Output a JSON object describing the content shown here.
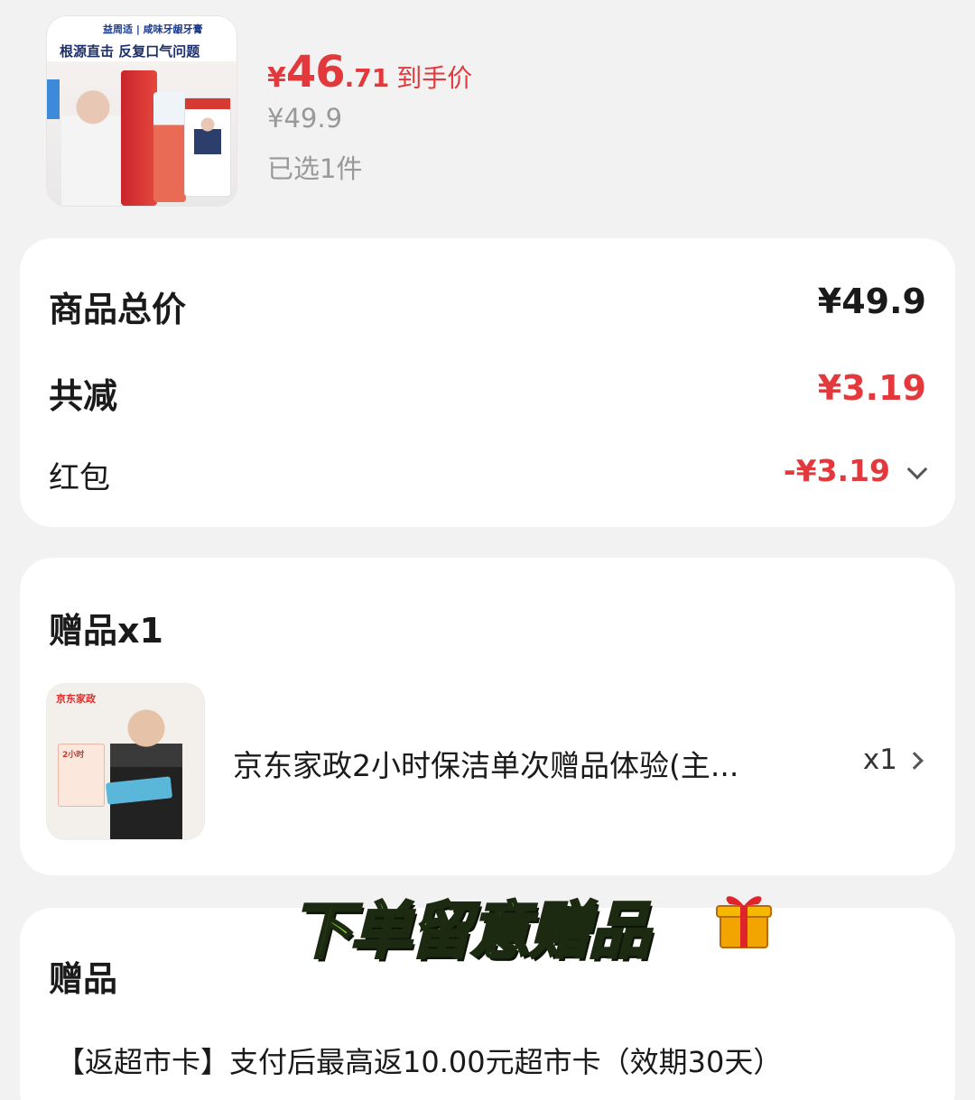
{
  "product": {
    "thumb_brand": "益周适 | 咸味牙龈牙膏",
    "thumb_headline": "根源直击 反复口气问题",
    "price_symbol": "¥",
    "price_integer": "46",
    "price_decimal": ".71",
    "price_suffix": "到手价",
    "original_price": "¥49.9",
    "selected_count": "已选1件"
  },
  "summary": {
    "total_label": "商品总价",
    "total_value": "¥49.9",
    "reduction_label": "共减",
    "reduction_value": "¥3.19",
    "redpack_label": "红包",
    "redpack_value": "-¥3.19"
  },
  "gift": {
    "title": "赠品x1",
    "thumb_brand": "京东家政",
    "thumb_tag": "2小时",
    "name": "京东家政2小时保洁单次赠品体验(主...",
    "quantity": "x1"
  },
  "gift_section2": {
    "title": "赠品",
    "text": "【返超市卡】支付后最高返10.00元超市卡（效期30天）"
  },
  "overlay": {
    "sticker_text": "下单留意赠品"
  },
  "colors": {
    "accent_red": "#e4393c",
    "background": "#f2f2f2",
    "card": "#ffffff",
    "sticker_green": "#8be03a"
  },
  "icons": [
    "chevron-down-icon",
    "chevron-right-icon",
    "gift-box-icon"
  ]
}
